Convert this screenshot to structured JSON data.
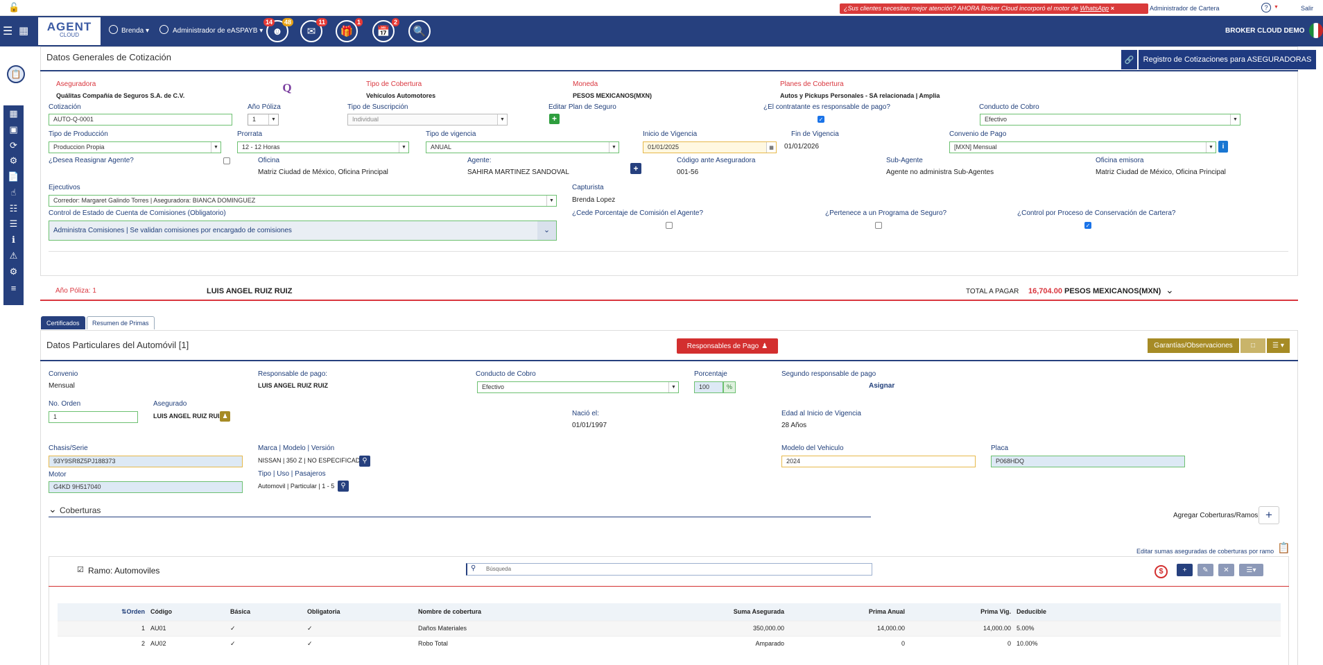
{
  "topbar": {
    "promo_text": "¿Sus clientes necesitan mejor atención? AHORA Broker Cloud incorporó el motor de",
    "promo_link": "WhatsApp",
    "promo_close": "×",
    "admin_label": "Administrador de Cartera",
    "help_icon": "?",
    "exit_label": "Salir"
  },
  "navbar": {
    "logo_main": "AGENT",
    "logo_sub": "CLOUD",
    "user": "Brenda",
    "admin": "Administrador de eASPAYB",
    "badges": {
      "agents": "14",
      "agents2": "48",
      "mail": "11",
      "gift": "1",
      "calendar": "2"
    },
    "brand": "BROKER CLOUD DEMO"
  },
  "general": {
    "title": "Datos Generales de Cotización",
    "registro_button": "Registro de Cotizaciones para ASEGURADORAS",
    "aseguradora_label": "Aseguradora",
    "aseguradora_value": "Quálitas Compañía de Seguros S.A. de C.V.",
    "logo_text": "Q",
    "tipo_cobertura_label": "Tipo de Cobertura",
    "tipo_cobertura_value": "Vehículos Automotores",
    "moneda_label": "Moneda",
    "moneda_value": "PESOS MEXICANOS(MXN)",
    "planes_label": "Planes de Cobertura",
    "planes_value": "Autos y Pickups Personales - SA relacionada | Amplia",
    "cotizacion_label": "Cotización",
    "cotizacion_value": "AUTO-Q-0001",
    "anio_poliza_label": "Año Póliza",
    "anio_poliza_value": "1",
    "tipo_suscripcion_label": "Tipo de Suscripción",
    "tipo_suscripcion_value": "Individual",
    "editar_plan_label": "Editar Plan de Seguro",
    "contratante_label": "¿El contratante es responsable de pago?",
    "conducto_label": "Conducto de Cobro",
    "conducto_value": "Efectivo",
    "tipo_produccion_label": "Tipo de Producción",
    "tipo_produccion_value": "Produccion Propia",
    "prorrata_label": "Prorrata",
    "prorrata_value": "12 - 12 Horas",
    "tipo_vigencia_label": "Tipo de vigencia",
    "tipo_vigencia_value": "ANUAL",
    "inicio_label": "Inicio de Vigencia",
    "inicio_value": "01/01/2025",
    "fin_label": "Fin de Vigencia",
    "fin_value": "01/01/2026",
    "convenio_label": "Convenio de Pago",
    "convenio_value": "[MXN] Mensual",
    "reasignar_label": "¿Desea Reasignar Agente?",
    "oficina_label": "Oficina",
    "oficina_value": "Matriz Ciudad de México, Oficina Principal",
    "agente_label": "Agente:",
    "agente_value": "SAHIRA MARTINEZ SANDOVAL",
    "codigo_label": "Código ante Aseguradora",
    "codigo_value": "001-56",
    "subagente_label": "Sub-Agente",
    "subagente_value": "Agente no administra Sub-Agentes",
    "oficina_emisora_label": "Oficina emisora",
    "oficina_emisora_value": "Matriz Ciudad de México, Oficina Principal",
    "ejecutivos_label": "Ejecutivos",
    "ejecutivos_value": "Corredor: Margaret Galindo Torres | Aseguradora: BIANCA DOMINGUEZ",
    "capturista_label": "Capturista",
    "capturista_value": "Brenda Lopez",
    "control_label": "Control de Estado de Cuenta de Comisiones (Obligatorio)",
    "control_value": "Administra Comisiones | Se validan comisiones por encargado de comisiones",
    "cede_label": "¿Cede Porcentaje de Comisión el Agente?",
    "programa_label": "¿Pertenece a un Programa de Seguro?",
    "conservacion_label": "¿Control por Proceso de Conservación de Cartera?"
  },
  "summary": {
    "anio_poliza": "Año Póliza: 1",
    "asegurado": "LUIS ANGEL RUIZ RUIZ",
    "total_label": "TOTAL A PAGAR",
    "total_value": "16,704.00",
    "total_currency": "PESOS MEXICANOS(MXN)"
  },
  "tabs": {
    "certificados": "Certificados",
    "resumen": "Resumen de Primas"
  },
  "auto": {
    "title": "Datos Particulares del Automóvil [1]",
    "responsables_button": "Responsables de Pago",
    "garantias_button": "Garantías/Observaciones",
    "convenio_label": "Convenio",
    "convenio_value": "Mensual",
    "responsable_label": "Responsable de pago:",
    "responsable_value": "LUIS ANGEL RUIZ RUIZ",
    "conducto_label": "Conducto de Cobro",
    "conducto_value": "Efectivo",
    "porcentaje_label": "Porcentaje",
    "porcentaje_value": "100",
    "porcentaje_symbol": "%",
    "segundo_label": "Segundo responsable de pago",
    "asignar": "Asignar",
    "orden_label": "No. Orden",
    "orden_value": "1",
    "asegurado_label": "Asegurado",
    "asegurado_value": "LUIS ANGEL RUIZ RUIZ",
    "nacio_label": "Nació el:",
    "nacio_value": "01/01/1997",
    "edad_label": "Edad al Inicio de Vigencia",
    "edad_value": "28 Años",
    "chasis_label": "Chasis/Serie",
    "chasis_value": "93Y9SR8Z5PJ188373",
    "marca_label": "Marca | Modelo | Versión",
    "marca_value": "NISSAN | 350 Z | NO ESPECIFICADO",
    "modelo_label": "Modelo del Vehiculo",
    "modelo_value": "2024",
    "placa_label": "Placa",
    "placa_value": "P068HDQ",
    "motor_label": "Motor",
    "motor_value": "G4KD 9H517040",
    "tipo_label": "Tipo | Uso | Pasajeros",
    "tipo_value": "Automovil | Particular | 1 - 5"
  },
  "coberturas": {
    "title": "Coberturas",
    "agregar": "Agregar Coberturas/Ramos",
    "editar_sumas": "Editar sumas aseguradas de coberturas por ramo",
    "ramo_title": "Ramo: Automoviles",
    "search_placeholder": "Búsqueda",
    "columns": [
      "Orden",
      "Código",
      "Básica",
      "Obligatoria",
      "Nombre de cobertura",
      "Suma Asegurada",
      "Prima Anual",
      "Prima Vig.",
      "Deducible"
    ],
    "rows": [
      {
        "orden": "1",
        "codigo": "AU01",
        "basica": "✓",
        "obligatoria": "✓",
        "nombre": "Daños Materiales",
        "suma": "350,000.00",
        "prima_anual": "14,000.00",
        "prima_vig": "14,000.00",
        "deducible": "5.00%"
      },
      {
        "orden": "2",
        "codigo": "AU02",
        "basica": "✓",
        "obligatoria": "✓",
        "nombre": "Robo Total",
        "suma": "Amparado",
        "prima_anual": "0",
        "prima_vig": "0",
        "deducible": "10.00%"
      }
    ]
  }
}
